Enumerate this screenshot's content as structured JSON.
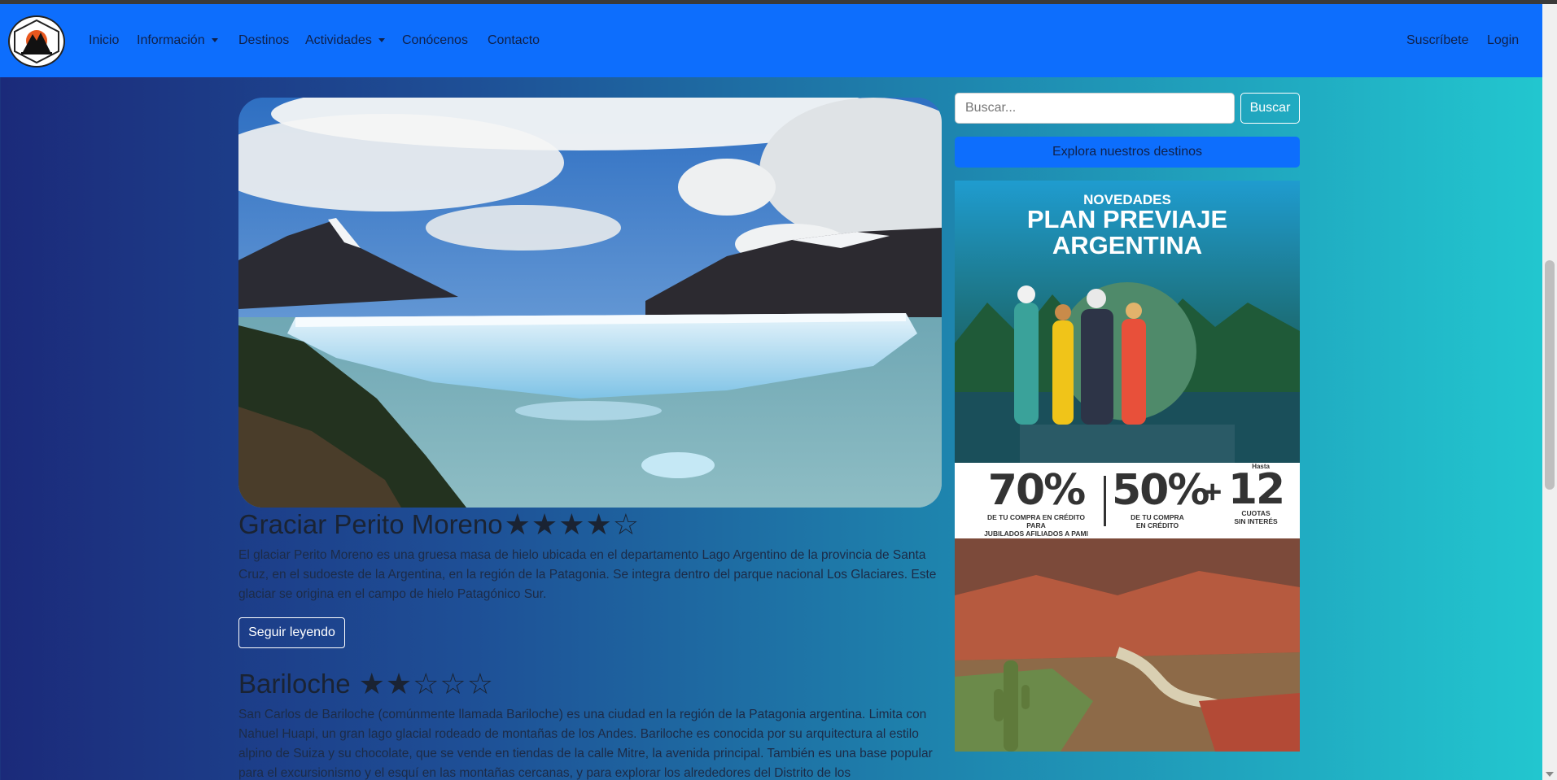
{
  "nav": {
    "logo_alt": "logo",
    "items": [
      {
        "label": "Inicio"
      },
      {
        "label": "Información"
      },
      {
        "label": "Destinos"
      },
      {
        "label": "Actividades"
      },
      {
        "label": "Conócenos"
      },
      {
        "label": "Contacto"
      }
    ],
    "right": [
      {
        "label": "Suscríbete"
      },
      {
        "label": "Login"
      }
    ]
  },
  "search": {
    "placeholder": "Buscar...",
    "button_label": "Buscar",
    "explore_label": "Explora nuestros destinos"
  },
  "articles": [
    {
      "title": "Graciar Perito Moreno",
      "rating": 4,
      "max_rating": 5,
      "body": "El glaciar Perito Moreno es una gruesa masa de hielo ubicada en el departamento Lago Argentino de la provincia de Santa Cruz, en el sudoeste de la Argentina, en la región de la Patagonia. Se integra dentro del parque nacional Los Glaciares. Este glaciar se origina en el campo de hielo Patagónico Sur.",
      "button": "Seguir leyendo"
    },
    {
      "title": "Bariloche",
      "rating": 2,
      "max_rating": 5,
      "body": "San Carlos de Bariloche (comúnmente llamada Bariloche) es una ciudad en la región de la Patagonia argentina. Limita con Nahuel Huapi, un gran lago glacial rodeado de montañas de los Andes. Bariloche es conocida por su arquitectura al estilo alpino de Suiza y su chocolate, que se vende en tiendas de la calle Mitre, la avenida principal. También es una base popular para el excursionismo y el esquí en las montañas cercanas, y para explorar los alrededores del Distrito de los"
    }
  ],
  "promo": {
    "kicker": "NOVEDADES",
    "title_line1": "PLAN PREVIAJE",
    "title_line2": "ARGENTINA",
    "offer1_value": "70%",
    "offer1_caption_1": "DE TU COMPRA EN CRÉDITO PARA",
    "offer1_caption_2": "JUBILADOS AFILIADOS A PAMI",
    "offer2_value": "50%",
    "offer2_caption_1": "DE TU COMPRA",
    "offer2_caption_2": "EN CRÉDITO",
    "plus": "+",
    "offer3_prefix": "Hasta",
    "offer3_value": "12",
    "offer3_caption_1": "CUOTAS",
    "offer3_caption_2": "SIN INTERÉS"
  },
  "colors": {
    "navbar": "#0d6efd",
    "accent": "#0d6efd"
  }
}
